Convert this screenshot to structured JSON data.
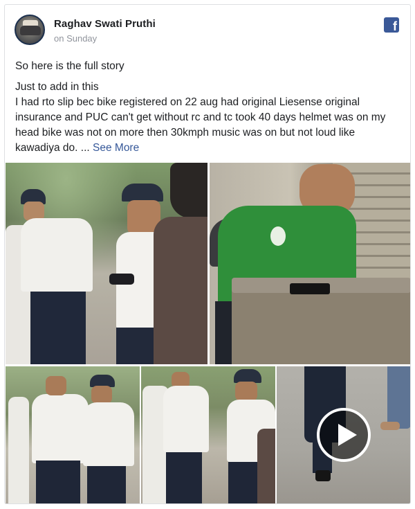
{
  "post": {
    "author": "Raghav Swati Pruthi",
    "timestamp": "on Sunday",
    "paragraph1": "So here is the full story",
    "paragraph2_line1": "Just to add in this",
    "paragraph2_body": "I had rto slip bec bike registered on 22 aug had original Liesense original insurance and PUC can't get without rc and tc took 40 days helmet was on my head bike was not on more then 30kmph music was on but not loud like kawadiya do. ...",
    "see_more": "See More"
  },
  "icons": {
    "platform": "facebook-icon",
    "play": "play-icon"
  },
  "colors": {
    "facebook_blue": "#3b5998",
    "link": "#365899",
    "meta_text": "#90949c",
    "border": "#dddfe2"
  }
}
